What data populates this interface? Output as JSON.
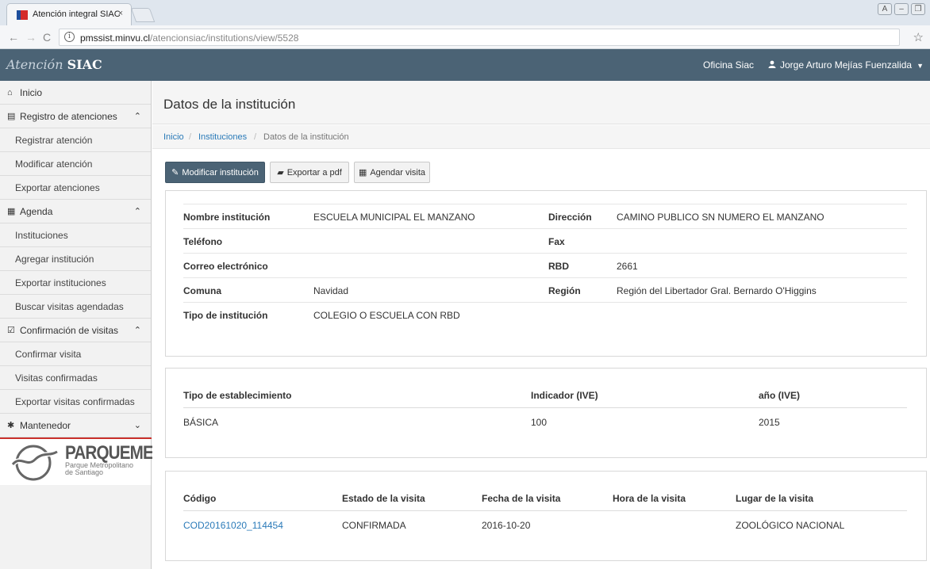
{
  "browser": {
    "tab_title": "Atención integral SIAC",
    "tab_close": "×",
    "url_host": "pmssist.minvu.cl",
    "url_path": "/atencionsiac/institutions/view/5528"
  },
  "navbar": {
    "brand_light": "Atención",
    "brand_bold": "SIAC",
    "office": "Oficina Siac",
    "user": "Jorge Arturo Mejías Fuenzalida"
  },
  "sidebar": {
    "inicio": "Inicio",
    "group_registro": "Registro de atenciones",
    "registro_items": [
      "Registrar atención",
      "Modificar atención",
      "Exportar atenciones"
    ],
    "group_agenda": "Agenda",
    "agenda_items": [
      "Instituciones",
      "Agregar institución",
      "Exportar instituciones",
      "Buscar visitas agendadas"
    ],
    "group_confirmacion": "Confirmación de visitas",
    "confirmacion_items": [
      "Confirmar visita",
      "Visitas confirmadas",
      "Exportar visitas confirmadas"
    ],
    "group_mantenedor": "Mantenedor",
    "logo_name": "PARQUEMET",
    "logo_sub1": "Parque Metropolitano",
    "logo_sub2": "de Santiago"
  },
  "page": {
    "title": "Datos de la institución",
    "breadcrumb": {
      "home": "Inicio",
      "sep": "/",
      "section": "Instituciones",
      "current": "Datos de la institución"
    },
    "buttons": {
      "modify": "Modificar institución",
      "export_pdf": "Exportar a pdf",
      "schedule": "Agendar visita"
    }
  },
  "institution": {
    "nombre_label": "Nombre institución",
    "nombre": "ESCUELA MUNICIPAL EL MANZANO",
    "direccion_label": "Dirección",
    "direccion": "CAMINO PUBLICO SN NUMERO EL MANZANO",
    "telefono_label": "Teléfono",
    "telefono": "",
    "fax_label": "Fax",
    "fax": "",
    "correo_label": "Correo electrónico",
    "correo": "",
    "rbd_label": "RBD",
    "rbd": "2661",
    "comuna_label": "Comuna",
    "comuna": "Navidad",
    "region_label": "Región",
    "region": "Región del Libertador Gral. Bernardo O'Higgins",
    "tipo_label": "Tipo de institución",
    "tipo": "COLEGIO O ESCUELA CON RBD"
  },
  "establishment": {
    "headers": [
      "Tipo de establecimiento",
      "Indicador (IVE)",
      "año (IVE)"
    ],
    "rows": [
      [
        "BÁSICA",
        "100",
        "2015"
      ]
    ]
  },
  "visits": {
    "headers": [
      "Código",
      "Estado de la visita",
      "Fecha de la visita",
      "Hora de la visita",
      "Lugar de la visita"
    ],
    "rows": [
      [
        "COD20161020_114454",
        "CONFIRMADA",
        "2016-10-20",
        "",
        "ZOOLÓGICO NACIONAL"
      ]
    ]
  },
  "colors": {
    "navbar": "#4b6375",
    "link": "#2a7ab8",
    "primary_button": "#4b6375"
  }
}
